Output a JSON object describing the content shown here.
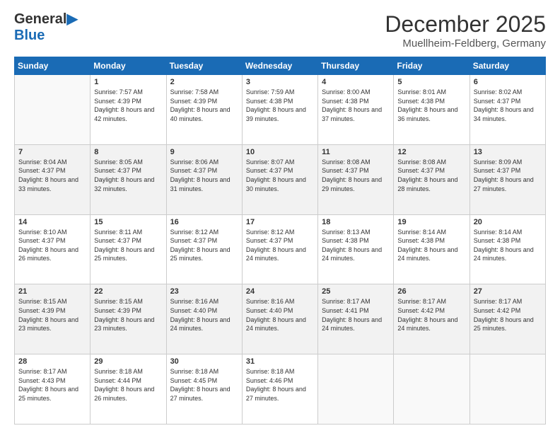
{
  "header": {
    "logo_general": "General",
    "logo_blue": "Blue",
    "month_title": "December 2025",
    "location": "Muellheim-Feldberg, Germany"
  },
  "days_of_week": [
    "Sunday",
    "Monday",
    "Tuesday",
    "Wednesday",
    "Thursday",
    "Friday",
    "Saturday"
  ],
  "weeks": [
    [
      {
        "day": "",
        "sunrise": "",
        "sunset": "",
        "daylight": ""
      },
      {
        "day": "1",
        "sunrise": "Sunrise: 7:57 AM",
        "sunset": "Sunset: 4:39 PM",
        "daylight": "Daylight: 8 hours and 42 minutes."
      },
      {
        "day": "2",
        "sunrise": "Sunrise: 7:58 AM",
        "sunset": "Sunset: 4:39 PM",
        "daylight": "Daylight: 8 hours and 40 minutes."
      },
      {
        "day": "3",
        "sunrise": "Sunrise: 7:59 AM",
        "sunset": "Sunset: 4:38 PM",
        "daylight": "Daylight: 8 hours and 39 minutes."
      },
      {
        "day": "4",
        "sunrise": "Sunrise: 8:00 AM",
        "sunset": "Sunset: 4:38 PM",
        "daylight": "Daylight: 8 hours and 37 minutes."
      },
      {
        "day": "5",
        "sunrise": "Sunrise: 8:01 AM",
        "sunset": "Sunset: 4:38 PM",
        "daylight": "Daylight: 8 hours and 36 minutes."
      },
      {
        "day": "6",
        "sunrise": "Sunrise: 8:02 AM",
        "sunset": "Sunset: 4:37 PM",
        "daylight": "Daylight: 8 hours and 34 minutes."
      }
    ],
    [
      {
        "day": "7",
        "sunrise": "Sunrise: 8:04 AM",
        "sunset": "Sunset: 4:37 PM",
        "daylight": "Daylight: 8 hours and 33 minutes."
      },
      {
        "day": "8",
        "sunrise": "Sunrise: 8:05 AM",
        "sunset": "Sunset: 4:37 PM",
        "daylight": "Daylight: 8 hours and 32 minutes."
      },
      {
        "day": "9",
        "sunrise": "Sunrise: 8:06 AM",
        "sunset": "Sunset: 4:37 PM",
        "daylight": "Daylight: 8 hours and 31 minutes."
      },
      {
        "day": "10",
        "sunrise": "Sunrise: 8:07 AM",
        "sunset": "Sunset: 4:37 PM",
        "daylight": "Daylight: 8 hours and 30 minutes."
      },
      {
        "day": "11",
        "sunrise": "Sunrise: 8:08 AM",
        "sunset": "Sunset: 4:37 PM",
        "daylight": "Daylight: 8 hours and 29 minutes."
      },
      {
        "day": "12",
        "sunrise": "Sunrise: 8:08 AM",
        "sunset": "Sunset: 4:37 PM",
        "daylight": "Daylight: 8 hours and 28 minutes."
      },
      {
        "day": "13",
        "sunrise": "Sunrise: 8:09 AM",
        "sunset": "Sunset: 4:37 PM",
        "daylight": "Daylight: 8 hours and 27 minutes."
      }
    ],
    [
      {
        "day": "14",
        "sunrise": "Sunrise: 8:10 AM",
        "sunset": "Sunset: 4:37 PM",
        "daylight": "Daylight: 8 hours and 26 minutes."
      },
      {
        "day": "15",
        "sunrise": "Sunrise: 8:11 AM",
        "sunset": "Sunset: 4:37 PM",
        "daylight": "Daylight: 8 hours and 25 minutes."
      },
      {
        "day": "16",
        "sunrise": "Sunrise: 8:12 AM",
        "sunset": "Sunset: 4:37 PM",
        "daylight": "Daylight: 8 hours and 25 minutes."
      },
      {
        "day": "17",
        "sunrise": "Sunrise: 8:12 AM",
        "sunset": "Sunset: 4:37 PM",
        "daylight": "Daylight: 8 hours and 24 minutes."
      },
      {
        "day": "18",
        "sunrise": "Sunrise: 8:13 AM",
        "sunset": "Sunset: 4:38 PM",
        "daylight": "Daylight: 8 hours and 24 minutes."
      },
      {
        "day": "19",
        "sunrise": "Sunrise: 8:14 AM",
        "sunset": "Sunset: 4:38 PM",
        "daylight": "Daylight: 8 hours and 24 minutes."
      },
      {
        "day": "20",
        "sunrise": "Sunrise: 8:14 AM",
        "sunset": "Sunset: 4:38 PM",
        "daylight": "Daylight: 8 hours and 24 minutes."
      }
    ],
    [
      {
        "day": "21",
        "sunrise": "Sunrise: 8:15 AM",
        "sunset": "Sunset: 4:39 PM",
        "daylight": "Daylight: 8 hours and 23 minutes."
      },
      {
        "day": "22",
        "sunrise": "Sunrise: 8:15 AM",
        "sunset": "Sunset: 4:39 PM",
        "daylight": "Daylight: 8 hours and 23 minutes."
      },
      {
        "day": "23",
        "sunrise": "Sunrise: 8:16 AM",
        "sunset": "Sunset: 4:40 PM",
        "daylight": "Daylight: 8 hours and 24 minutes."
      },
      {
        "day": "24",
        "sunrise": "Sunrise: 8:16 AM",
        "sunset": "Sunset: 4:40 PM",
        "daylight": "Daylight: 8 hours and 24 minutes."
      },
      {
        "day": "25",
        "sunrise": "Sunrise: 8:17 AM",
        "sunset": "Sunset: 4:41 PM",
        "daylight": "Daylight: 8 hours and 24 minutes."
      },
      {
        "day": "26",
        "sunrise": "Sunrise: 8:17 AM",
        "sunset": "Sunset: 4:42 PM",
        "daylight": "Daylight: 8 hours and 24 minutes."
      },
      {
        "day": "27",
        "sunrise": "Sunrise: 8:17 AM",
        "sunset": "Sunset: 4:42 PM",
        "daylight": "Daylight: 8 hours and 25 minutes."
      }
    ],
    [
      {
        "day": "28",
        "sunrise": "Sunrise: 8:17 AM",
        "sunset": "Sunset: 4:43 PM",
        "daylight": "Daylight: 8 hours and 25 minutes."
      },
      {
        "day": "29",
        "sunrise": "Sunrise: 8:18 AM",
        "sunset": "Sunset: 4:44 PM",
        "daylight": "Daylight: 8 hours and 26 minutes."
      },
      {
        "day": "30",
        "sunrise": "Sunrise: 8:18 AM",
        "sunset": "Sunset: 4:45 PM",
        "daylight": "Daylight: 8 hours and 27 minutes."
      },
      {
        "day": "31",
        "sunrise": "Sunrise: 8:18 AM",
        "sunset": "Sunset: 4:46 PM",
        "daylight": "Daylight: 8 hours and 27 minutes."
      },
      {
        "day": "",
        "sunrise": "",
        "sunset": "",
        "daylight": ""
      },
      {
        "day": "",
        "sunrise": "",
        "sunset": "",
        "daylight": ""
      },
      {
        "day": "",
        "sunrise": "",
        "sunset": "",
        "daylight": ""
      }
    ]
  ]
}
